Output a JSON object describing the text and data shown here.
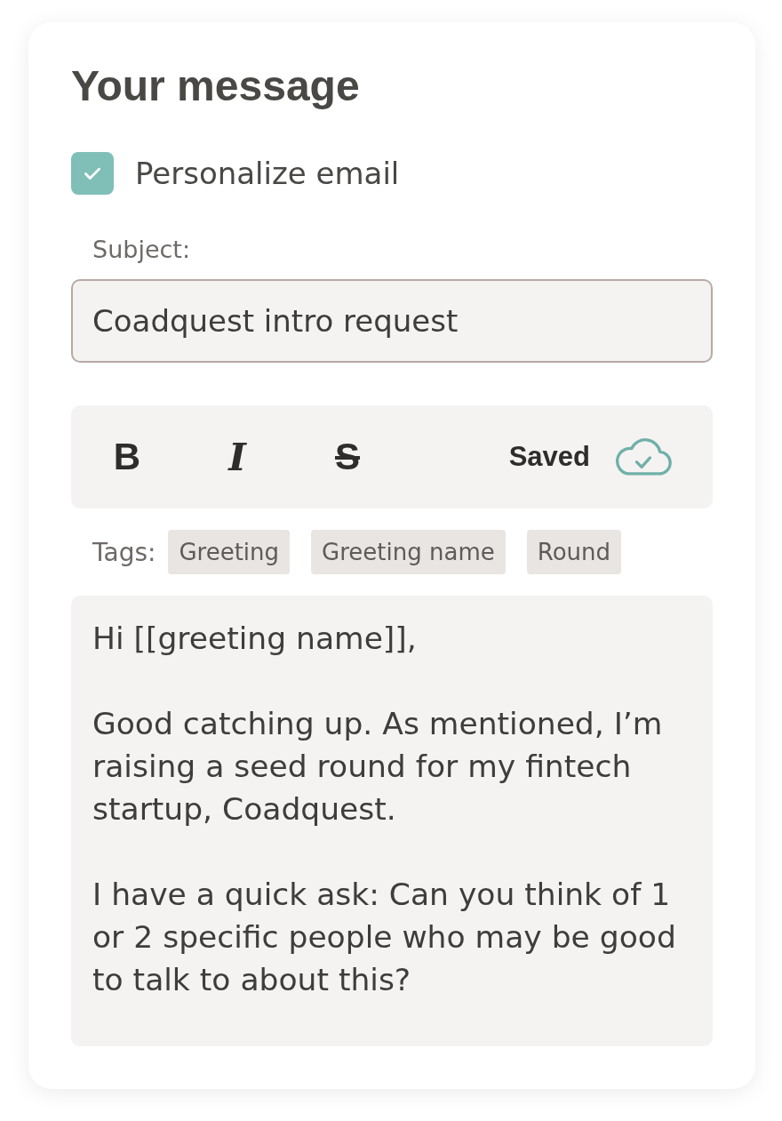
{
  "title": "Your message",
  "personalize": {
    "label": "Personalize email",
    "checked": true
  },
  "subject": {
    "label": "Subject:",
    "value": "Coadquest intro request"
  },
  "toolbar": {
    "buttons": [
      {
        "label": "B",
        "kind": "bold"
      },
      {
        "label": "I",
        "kind": "italic"
      },
      {
        "label": "S",
        "kind": "strike"
      }
    ],
    "status": "Saved"
  },
  "tags": {
    "label": "Tags:",
    "items": [
      "Greeting",
      "Greeting name",
      "Round"
    ]
  },
  "body": [
    "Hi [[greeting name]],",
    "Good catching up. As mentioned, I’m raising a seed round for my fintech startup, Coadquest.",
    "I have a quick ask: Can you think of 1 or 2 specific people who may be good to talk to about this?"
  ]
}
